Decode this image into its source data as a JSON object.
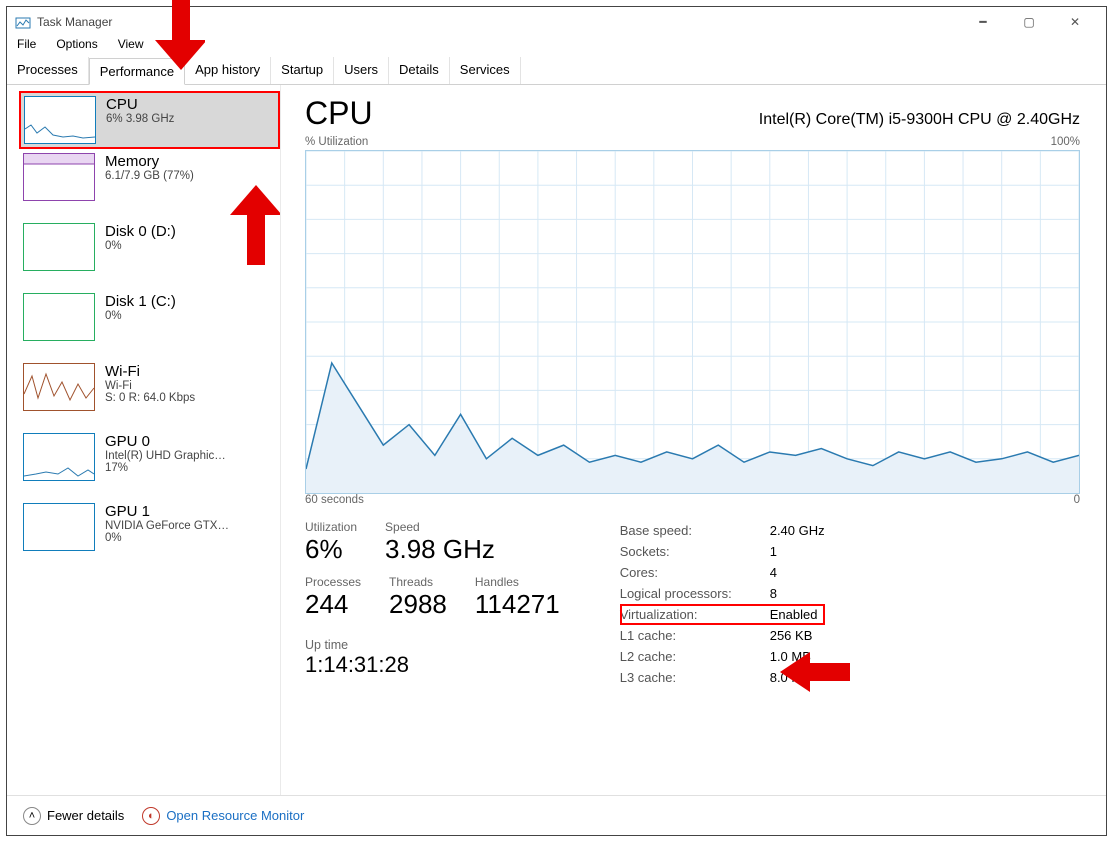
{
  "window": {
    "title": "Task Manager"
  },
  "menu": {
    "file": "File",
    "options": "Options",
    "view": "View"
  },
  "tabs": [
    "Processes",
    "Performance",
    "App history",
    "Startup",
    "Users",
    "Details",
    "Services"
  ],
  "active_tab": "Performance",
  "sidebar": {
    "items": [
      {
        "title": "CPU",
        "sub": "6%  3.98 GHz"
      },
      {
        "title": "Memory",
        "sub": "6.1/7.9 GB (77%)"
      },
      {
        "title": "Disk 0 (D:)",
        "sub": "0%"
      },
      {
        "title": "Disk 1 (C:)",
        "sub": "0%"
      },
      {
        "title": "Wi-Fi",
        "sub": "Wi-Fi",
        "sub2": "S: 0 R: 64.0 Kbps"
      },
      {
        "title": "GPU 0",
        "sub": "Intel(R) UHD Graphic…",
        "sub2": "17%"
      },
      {
        "title": "GPU 1",
        "sub": "NVIDIA GeForce GTX…",
        "sub2": "0%"
      }
    ]
  },
  "main": {
    "title": "CPU",
    "subtitle": "Intel(R) Core(TM) i5-9300H CPU @ 2.40GHz",
    "top_left": "% Utilization",
    "top_right": "100%",
    "bot_left": "60 seconds",
    "bot_right": "0",
    "stats": {
      "util_lbl": "Utilization",
      "util": "6%",
      "speed_lbl": "Speed",
      "speed": "3.98 GHz",
      "proc_lbl": "Processes",
      "proc": "244",
      "thr_lbl": "Threads",
      "thr": "2988",
      "han_lbl": "Handles",
      "han": "114271",
      "up_lbl": "Up time",
      "up": "1:14:31:28"
    },
    "info": [
      {
        "k": "Base speed:",
        "v": "2.40 GHz"
      },
      {
        "k": "Sockets:",
        "v": "1"
      },
      {
        "k": "Cores:",
        "v": "4"
      },
      {
        "k": "Logical processors:",
        "v": "8"
      },
      {
        "k": "Virtualization:",
        "v": "Enabled"
      },
      {
        "k": "L1 cache:",
        "v": "256 KB"
      },
      {
        "k": "L2 cache:",
        "v": "1.0 MB"
      },
      {
        "k": "L3 cache:",
        "v": "8.0 MB"
      }
    ]
  },
  "footer": {
    "fewer": "Fewer details",
    "orm": "Open Resource Monitor"
  },
  "chart_data": {
    "type": "line",
    "title": "% Utilization",
    "xlabel": "seconds",
    "ylabel": "%",
    "xlim": [
      0,
      60
    ],
    "ylim": [
      0,
      100
    ],
    "x": [
      0,
      2,
      4,
      6,
      8,
      10,
      12,
      14,
      16,
      18,
      20,
      22,
      24,
      26,
      28,
      30,
      32,
      34,
      36,
      38,
      40,
      42,
      44,
      46,
      48,
      50,
      52,
      54,
      56,
      58,
      60
    ],
    "y": [
      7,
      38,
      26,
      14,
      20,
      11,
      23,
      10,
      16,
      11,
      14,
      9,
      11,
      9,
      12,
      10,
      14,
      9,
      12,
      11,
      13,
      10,
      8,
      12,
      10,
      12,
      9,
      10,
      12,
      9,
      11
    ]
  }
}
